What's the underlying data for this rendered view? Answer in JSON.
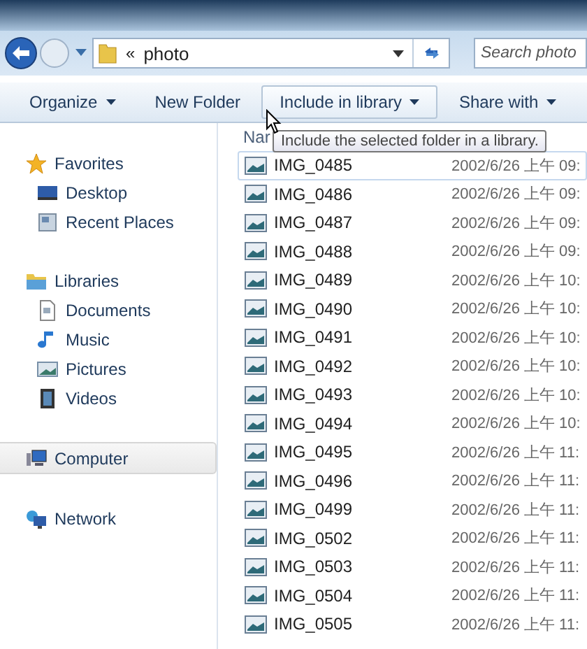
{
  "address": {
    "chevron": "«",
    "path": "photo"
  },
  "search": {
    "placeholder": "Search photo"
  },
  "toolbar": [
    {
      "label": "Organize",
      "menu": true,
      "hovered": false
    },
    {
      "label": "New Folder",
      "menu": false,
      "hovered": false
    },
    {
      "label": "Include in library",
      "menu": true,
      "hovered": true
    },
    {
      "label": "Share with",
      "menu": true,
      "hovered": false
    }
  ],
  "tooltip": "Include the selected folder in a library.",
  "sidebar": [
    {
      "label": "Favorites",
      "kind": "star",
      "selected": false,
      "children": [
        {
          "label": "Desktop",
          "kind": "desktop",
          "selected": false
        },
        {
          "label": "Recent Places",
          "kind": "recent",
          "selected": false
        }
      ]
    },
    {
      "label": "Libraries",
      "kind": "library",
      "selected": false,
      "children": [
        {
          "label": "Documents",
          "kind": "document",
          "selected": false
        },
        {
          "label": "Music",
          "kind": "music",
          "selected": false
        },
        {
          "label": "Pictures",
          "kind": "pictures",
          "selected": false
        },
        {
          "label": "Videos",
          "kind": "video",
          "selected": false
        }
      ]
    },
    {
      "label": "Computer",
      "kind": "computer",
      "selected": true
    },
    {
      "label": "Network",
      "kind": "network",
      "selected": false
    }
  ],
  "table": {
    "columns": [
      "Nar"
    ],
    "rows": [
      {
        "name": "IMG_0485",
        "date": "2002/6/26 上午 09:",
        "focused": true
      },
      {
        "name": "IMG_0486",
        "date": "2002/6/26 上午 09:",
        "focused": false
      },
      {
        "name": "IMG_0487",
        "date": "2002/6/26 上午 09:",
        "focused": false
      },
      {
        "name": "IMG_0488",
        "date": "2002/6/26 上午 09:",
        "focused": false
      },
      {
        "name": "IMG_0489",
        "date": "2002/6/26 上午 10:",
        "focused": false
      },
      {
        "name": "IMG_0490",
        "date": "2002/6/26 上午 10:",
        "focused": false
      },
      {
        "name": "IMG_0491",
        "date": "2002/6/26 上午 10:",
        "focused": false
      },
      {
        "name": "IMG_0492",
        "date": "2002/6/26 上午 10:",
        "focused": false
      },
      {
        "name": "IMG_0493",
        "date": "2002/6/26 上午 10:",
        "focused": false
      },
      {
        "name": "IMG_0494",
        "date": "2002/6/26 上午 10:",
        "focused": false
      },
      {
        "name": "IMG_0495",
        "date": "2002/6/26 上午 11:",
        "focused": false
      },
      {
        "name": "IMG_0496",
        "date": "2002/6/26 上午 11:",
        "focused": false
      },
      {
        "name": "IMG_0499",
        "date": "2002/6/26 上午 11:",
        "focused": false
      },
      {
        "name": "IMG_0502",
        "date": "2002/6/26 上午 11:",
        "focused": false
      },
      {
        "name": "IMG_0503",
        "date": "2002/6/26 上午 11:",
        "focused": false
      },
      {
        "name": "IMG_0504",
        "date": "2002/6/26 上午 11:",
        "focused": false
      },
      {
        "name": "IMG_0505",
        "date": "2002/6/26 上午 11:",
        "focused": false
      }
    ]
  }
}
